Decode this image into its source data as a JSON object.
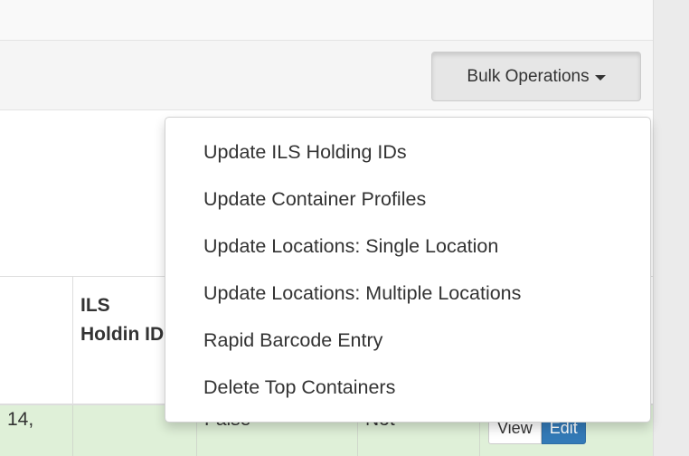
{
  "toolbar": {
    "bulk_label": "Bulk Operations"
  },
  "bulk_menu": {
    "items": [
      "Update ILS Holding IDs",
      "Update Container Profiles",
      "Update Locations: Single Location",
      "Update Locations: Multiple Locations",
      "Rapid Barcode Entry",
      "Delete Top Containers"
    ]
  },
  "table": {
    "header": {
      "ils_holding_id": "ILS Holdin ID"
    },
    "row": {
      "col1_partial": "14,",
      "col2": "",
      "col3": "False",
      "col4": "Not"
    },
    "actions": {
      "view_label": "View",
      "edit_label": "Edit"
    }
  },
  "colors": {
    "primary": "#337ab7",
    "success_row": "#dff0d8",
    "button_active": "#e6e6e6"
  }
}
